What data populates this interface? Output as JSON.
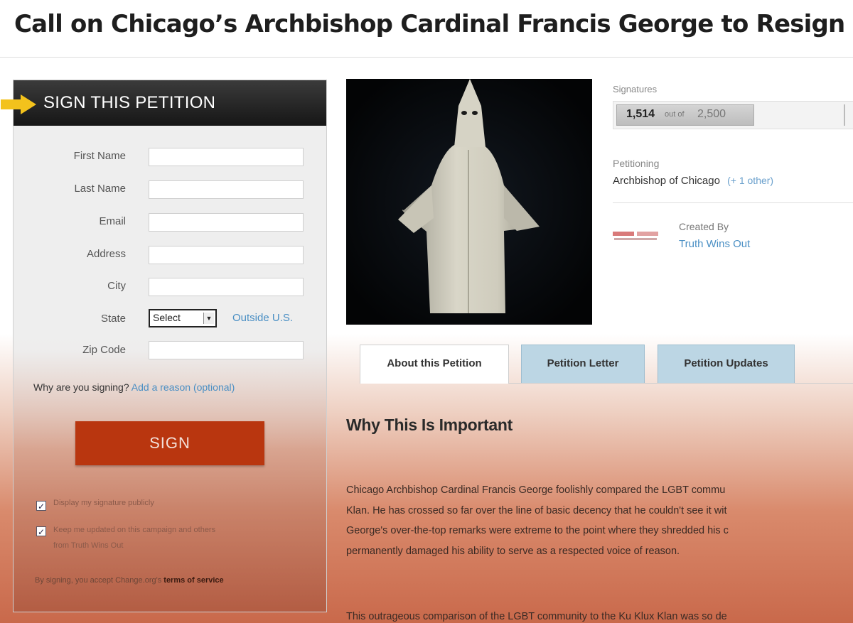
{
  "page": {
    "title": "Call on Chicago’s Archbishop Cardinal Francis George to Resign"
  },
  "sign_panel": {
    "header": "SIGN THIS PETITION",
    "fields": [
      {
        "label": "First Name",
        "value": ""
      },
      {
        "label": "Last Name",
        "value": ""
      },
      {
        "label": "Email",
        "value": ""
      },
      {
        "label": "Address",
        "value": ""
      },
      {
        "label": "City",
        "value": ""
      },
      {
        "label": "State",
        "value": "Select"
      },
      {
        "label": "Zip Code",
        "value": ""
      }
    ],
    "outside_us_link": "Outside U.S.",
    "why_prompt": "Why are you signing?",
    "why_link": "Add a reason (optional)",
    "sign_button": "SIGN",
    "checkbox_display": {
      "label": "Display my signature publicly",
      "checked": true
    },
    "checkbox_updates": {
      "label_line1": "Keep me updated on this campaign and others",
      "label_line2": "from Truth Wins Out",
      "checked": true
    },
    "terms_prefix": "By signing, you accept Change.org's",
    "terms_link": "terms of service"
  },
  "photo": {
    "icon": "robed-hooded-figure-image"
  },
  "stats": {
    "signatures_label": "Signatures",
    "count_text": "1,514",
    "out_of_text": "out of",
    "goal_text": "2,500",
    "count": 1514,
    "goal": 2500,
    "petitioning_label": "Petitioning",
    "target": "Archbishop of Chicago",
    "other": "(+ 1 other)",
    "created_by_label": "Created By",
    "creator": "Truth Wins Out"
  },
  "tabs": [
    {
      "label": "About this Petition",
      "active": true
    },
    {
      "label": "Petition Letter",
      "active": false
    },
    {
      "label": "Petition Updates",
      "active": false
    }
  ],
  "content": {
    "heading": "Why This Is Important",
    "paragraph1_lines": [
      "Chicago Archbishop Cardinal Francis George foolishly compared the LGBT commu",
      "Klan. He has crossed so far over the line of basic decency that he couldn't see it wit",
      "George's over-the-top remarks were extreme to the point where they shredded his c",
      "permanently damaged his ability to serve as a respected voice of reason."
    ],
    "paragraph2_line": "This outrageous comparison of the LGBT community to the Ku Klux Klan was so de"
  },
  "colors": {
    "sign_button": "#b9360f",
    "link": "#4a8fc4",
    "tab_inactive": "#bcd6e4",
    "header_dark": "#1e1e1e"
  }
}
